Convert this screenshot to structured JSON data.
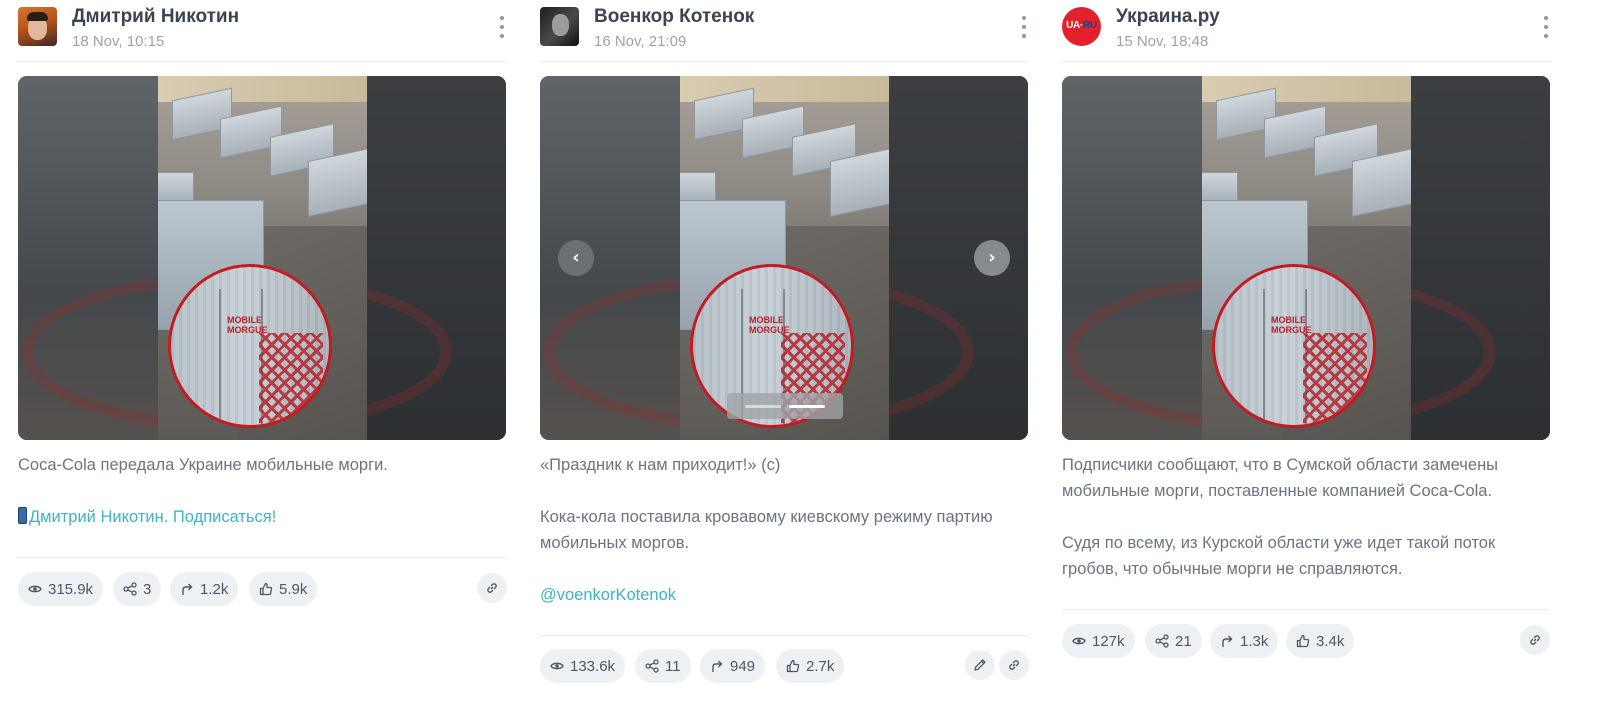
{
  "posts": [
    {
      "author": "Дмитрий Никотин",
      "date": "18 Nov, 10:15",
      "text": [
        "Coca-Cola передала Украине мобильные морги.",
        ""
      ],
      "link": "Дмитрий Никотин. Подписаться!",
      "stats": {
        "views": "315.9k",
        "shares": "3",
        "forwards": "1.2k",
        "reactions": "5.9k"
      }
    },
    {
      "author": "Военкор Котенок",
      "date": "16 Nov, 21:09",
      "text": [
        "«Праздник к нам приходит!» (с)",
        "",
        "Кока-кола поставила кровавому киевскому режиму партию мобильных моргов.",
        ""
      ],
      "link": "@voenkorKotenok",
      "stats": {
        "views": "133.6k",
        "shares": "11",
        "forwards": "949",
        "reactions": "2.7k"
      }
    },
    {
      "author": "Украина.ру",
      "date": "15 Nov, 18:48",
      "text": [
        "Подписчики сообщают, что в Сумской области замечены мобильные морги, поставленные компанией Coca-Cola.",
        "",
        "Судя по всему, из Курской области уже идет такой поток гробов, что обычные морги не справляются."
      ],
      "stats": {
        "views": "127k",
        "shares": "21",
        "forwards": "1.3k",
        "reactions": "3.4k"
      }
    }
  ],
  "image_overlay": {
    "line1": "MOBILE",
    "line2": "MORGUE"
  },
  "avatar_logo": {
    "a": "UA",
    "b": "RU"
  },
  "colors": {
    "link": "#3fb2c8",
    "pill_bg": "#eef1f4",
    "name": "#3a4452",
    "text": "#6b7480",
    "morgue_red": "#c41a22"
  },
  "icons": {
    "views": "eye-icon",
    "shares": "share-nodes-icon",
    "forwards": "forward-arrow-icon",
    "reactions": "thumbs-up-icon",
    "menu": "kebab-icon",
    "edit": "pencil-icon",
    "link": "link-icon",
    "prev": "chevron-left-icon",
    "next": "chevron-right-icon"
  }
}
